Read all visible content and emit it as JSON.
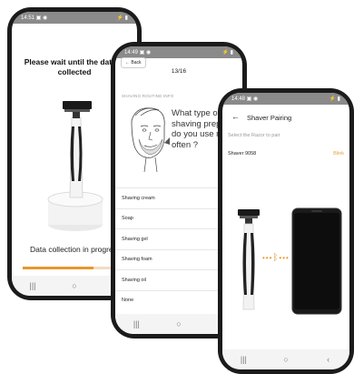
{
  "colors": {
    "accent": "#e8962c",
    "frame": "#1b1b1b"
  },
  "screen1": {
    "wait_message": "Please wait until the data is collected",
    "progress_label": "Data collection in progress",
    "progress_fraction": 0.62
  },
  "screen2": {
    "back_label": "Back",
    "counter": "13/16",
    "section_label": "SHAVING ROUTINE INFO",
    "question": "What type of shaving preparation do you use most often ?",
    "options": [
      "Shaving cream",
      "Soap",
      "Shaving gel",
      "Shaving foam",
      "Shaving oil",
      "None"
    ]
  },
  "screen3": {
    "title": "Shaver Pairing",
    "hint": "Select the Razor to pair",
    "device_name": "Shaver 9058",
    "blink_label": "Blink"
  },
  "icons": [
    "back-arrow-icon",
    "bluetooth-icon",
    "razor-icon",
    "face-sketch-icon",
    "phone-icon"
  ]
}
